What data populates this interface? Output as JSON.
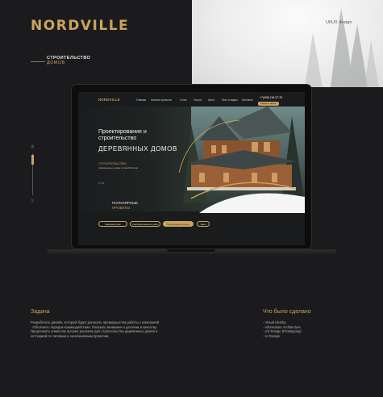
{
  "brand": {
    "logo": "NORDVILLE",
    "subtitle_line1": "СТРОИТЕЛЬСТВО",
    "subtitle_line2": "ДОМОВ"
  },
  "tag": {
    "uiux": "UI/UX design"
  },
  "pager": {
    "current": "01",
    "total": "05"
  },
  "site": {
    "logo": "NORDVILLE",
    "nav": [
      "Главная",
      "Каталог проектов",
      "О нас",
      "Услуги",
      "Цена",
      "Фото и видео",
      "Контакты"
    ],
    "phone": "+7(495) 118-37-78",
    "cta": "Заказать звонок",
    "hero_line1": "Проектирование и",
    "hero_line2": "строительство",
    "hero_line3": "ДЕРЕВЯННЫХ ДОМОВ",
    "tagline": "СТРОИТЕЛЬСТВО",
    "tagline_sub": "современные дома по всей России",
    "counter": "1 / 4",
    "projects_title1": "ПОПУЛЯРНЫЕ",
    "projects_title2": "ПРОЕКТЫ",
    "chips": [
      "Каменный дом",
      "Комбинированные дома",
      "Популярные проекты",
      "Баня"
    ],
    "active_chip": 2
  },
  "task": {
    "heading": "Задача",
    "text": "Разработать дизайн, который будет доносить преимущества работы с компанией . Объяснить порядок взаимодействия. Показать внимание к деталям и качеству. Предложить клиентам лучшее решение для строительства деревянных домов и коттеджей по типовым и эксклюзивным проектам."
  },
  "done": {
    "heading": "Что было сделано",
    "items": [
      "- Visual Identity",
      "- Information Architecture",
      "- UX Design (Prototyping)",
      "- UI Design"
    ]
  },
  "colors": {
    "accent": "#c9a45c",
    "bg": "#1b1b1d"
  }
}
